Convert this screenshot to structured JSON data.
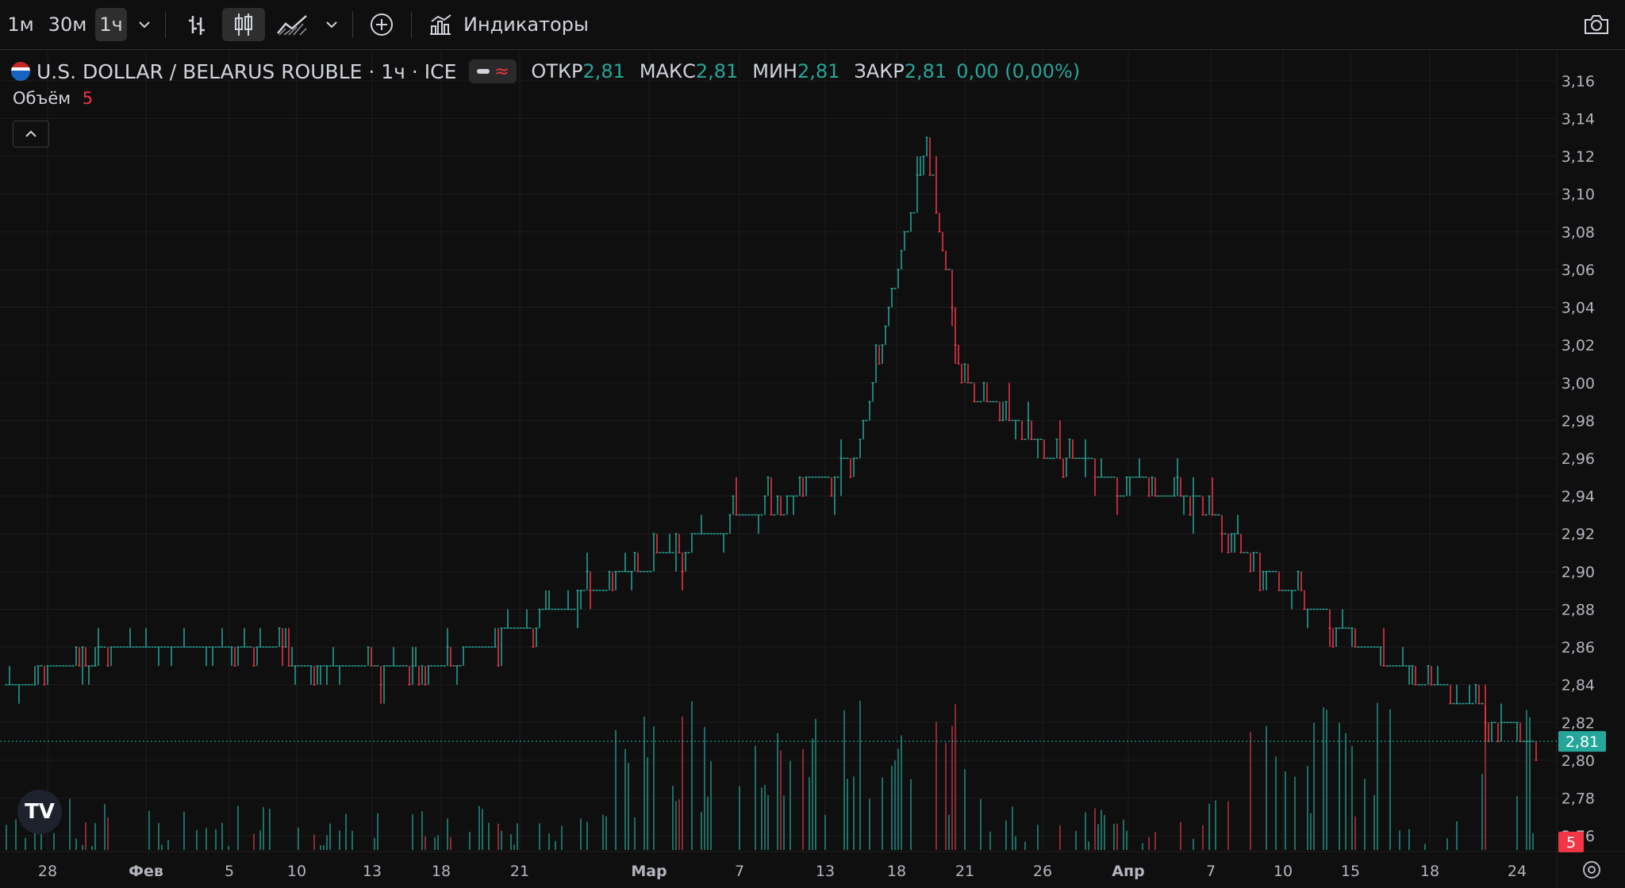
{
  "toolbar": {
    "interval_1m": "1м",
    "interval_30m": "30м",
    "interval_1h": "1ч",
    "indicators_label": "Индикаторы",
    "icons": [
      "chevron-down-icon",
      "bar-chart-icon",
      "candlestick-icon",
      "area-chart-icon",
      "chevron-down-icon",
      "plus-circle-icon",
      "indicators-icon",
      "camera-icon"
    ]
  },
  "legend": {
    "symbol": "U.S. DOLLAR / BELARUS ROUBLE · 1ч · ICE",
    "open_label": "ОТКР",
    "open_value": "2,81",
    "high_label": "МАКС",
    "high_value": "2,81",
    "low_label": "МИН",
    "low_value": "2,81",
    "close_label": "ЗАКР",
    "close_value": "2,81",
    "change": "0,00 (0,00%)",
    "volume_label": "Объём",
    "volume_value": "5"
  },
  "colors": {
    "background": "#0f0f0f",
    "up": "#26a69a",
    "down": "#f23645",
    "grid": "#1c1c1c",
    "text": "#d1d4dc"
  },
  "chart_data": {
    "type": "candlestick",
    "title": "U.S. DOLLAR / BELARUS ROUBLE · 1ч · ICE",
    "ylim": [
      2.755,
      3.165
    ],
    "y_ticks": [
      "3,16",
      "3,14",
      "3,12",
      "3,10",
      "3,08",
      "3,06",
      "3,04",
      "3,02",
      "3,00",
      "2,98",
      "2,96",
      "2,94",
      "2,92",
      "2,90",
      "2,88",
      "2,86",
      "2,84",
      "2,82",
      "2,80",
      "2,78",
      "2,76"
    ],
    "x_ticks": [
      "28",
      "Фев",
      "5",
      "10",
      "13",
      "18",
      "21",
      "Мар",
      "7",
      "13",
      "18",
      "21",
      "26",
      "Апр",
      "7",
      "10",
      "15",
      "18",
      "24"
    ],
    "last_price": "2,81",
    "last_volume": "5",
    "price_path": [
      {
        "period": "end Jan",
        "value": 2.84
      },
      {
        "period": "early Feb",
        "value": 2.86
      },
      {
        "period": "late Feb",
        "value": 2.85
      },
      {
        "period": "early Mar",
        "value": 2.9
      },
      {
        "period": "mid Mar",
        "value": 2.96
      },
      {
        "period": "Mar 19 high",
        "value": 3.13
      },
      {
        "period": "Mar 21",
        "value": 3.0
      },
      {
        "period": "late Mar",
        "value": 2.96
      },
      {
        "period": "Apr 7",
        "value": 2.94
      },
      {
        "period": "Apr 10",
        "value": 2.89
      },
      {
        "period": "mid Apr",
        "value": 2.85
      },
      {
        "period": "Apr 24",
        "value": 2.81
      }
    ]
  }
}
